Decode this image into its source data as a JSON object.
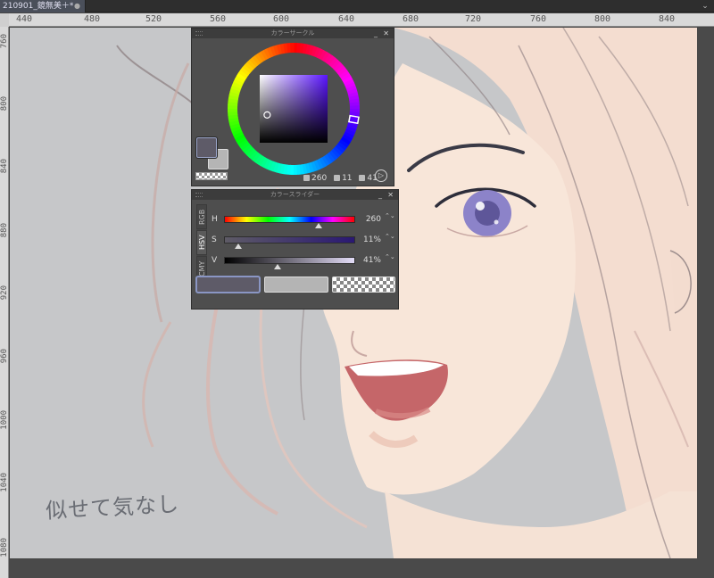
{
  "document": {
    "tab_title": "210901_鏡無美＋*",
    "tab_close": "●",
    "tab_menu": "⌄"
  },
  "rulers": {
    "top": [
      "440",
      "480",
      "520",
      "560",
      "600",
      "640",
      "680",
      "720",
      "760",
      "800",
      "840"
    ],
    "left": [
      "760",
      "800",
      "840",
      "880",
      "920",
      "960",
      "1000",
      "1040",
      "1080"
    ]
  },
  "canvas": {
    "handwriting": "似せて気なし"
  },
  "color_wheel": {
    "title": "カラーサークル",
    "minimize": "_",
    "close": "✕",
    "hue": "260",
    "saturation": "11",
    "value": "41",
    "main_color": "#5e5b68",
    "sub_color": "#b5b5b5",
    "mode_icon": "▷"
  },
  "color_slider": {
    "title": "カラースライダー",
    "minimize": "_",
    "close": "✕",
    "tabs": [
      "RGB",
      "HSV",
      "CMY"
    ],
    "active_tab": "HSV",
    "rows": [
      {
        "label": "H",
        "value": "260",
        "fraction": 0.722
      },
      {
        "label": "S",
        "value": "11%",
        "fraction": 0.11
      },
      {
        "label": "V",
        "value": "41%",
        "fraction": 0.41
      }
    ],
    "spin": "⌃⌄"
  },
  "colors": {
    "canvas_bg": "#c6c7c9",
    "skin": "#f7e4d6",
    "hair": "#f2d8ca",
    "line": "#8a7c7e",
    "eye": "#8c83c9"
  }
}
